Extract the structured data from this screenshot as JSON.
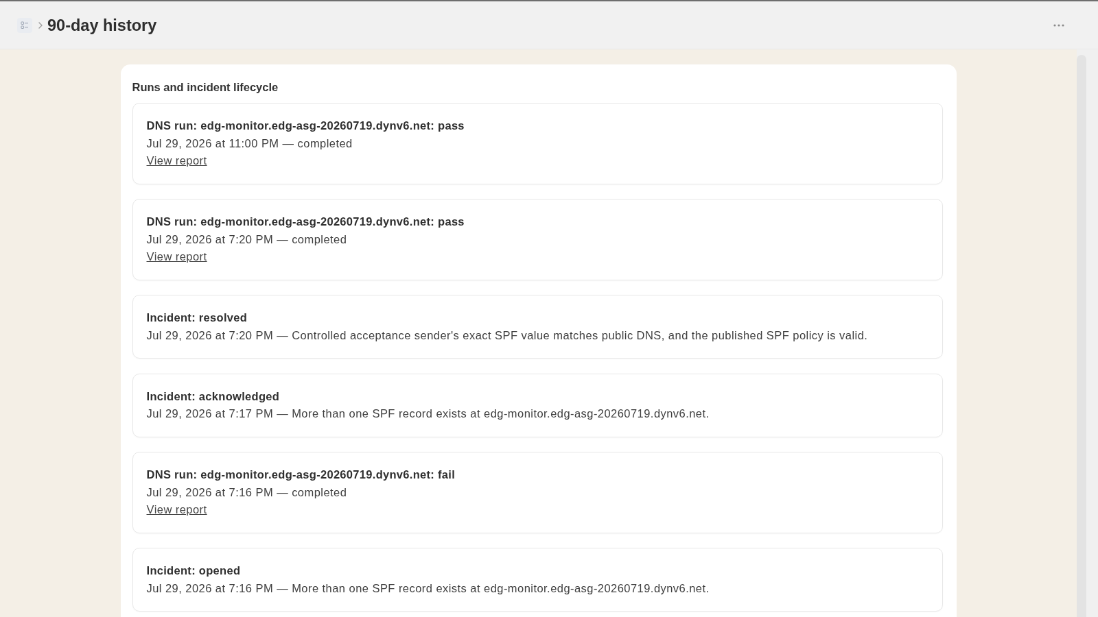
{
  "header": {
    "title": "90-day history"
  },
  "history": {
    "title": "Runs and incident lifecycle",
    "events": [
      {
        "title": "DNS run: edg-monitor.edg-asg-20260719.dynv6.net: pass",
        "detail": "Jul 29, 2026 at 11:00 PM — completed",
        "link": "View report"
      },
      {
        "title": "DNS run: edg-monitor.edg-asg-20260719.dynv6.net: pass",
        "detail": "Jul 29, 2026 at 7:20 PM — completed",
        "link": "View report"
      },
      {
        "title": "Incident: resolved",
        "detail": "Jul 29, 2026 at 7:20 PM — Controlled acceptance sender's exact SPF value matches public DNS, and the published SPF policy is valid."
      },
      {
        "title": "Incident: acknowledged",
        "detail": "Jul 29, 2026 at 7:17 PM — More than one SPF record exists at edg-monitor.edg-asg-20260719.dynv6.net."
      },
      {
        "title": "DNS run: edg-monitor.edg-asg-20260719.dynv6.net: fail",
        "detail": "Jul 29, 2026 at 7:16 PM — completed",
        "link": "View report"
      },
      {
        "title": "Incident: opened",
        "detail": "Jul 29, 2026 at 7:16 PM — More than one SPF record exists at edg-monitor.edg-asg-20260719.dynv6.net."
      }
    ]
  }
}
